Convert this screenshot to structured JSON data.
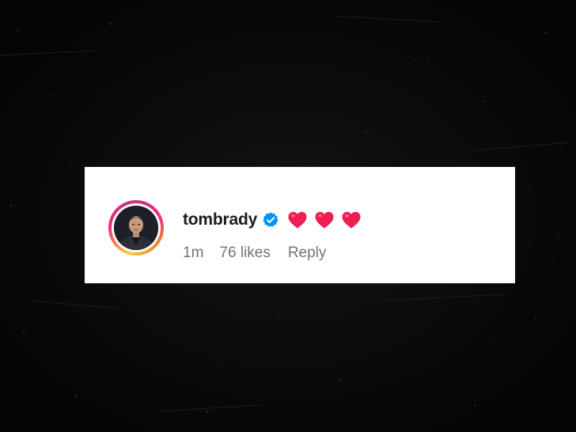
{
  "comment": {
    "username": "tombrady",
    "verified": true,
    "emoji_icons": [
      "red-heart-icon",
      "red-heart-icon",
      "red-heart-icon"
    ],
    "time": "1m",
    "likes": "76 likes",
    "reply_label": "Reply"
  },
  "colors": {
    "background": "#0a0a0a",
    "card": "#ffffff",
    "username": "#1c1c1c",
    "meta_text": "#737373",
    "verified_badge": "#0095f6",
    "heart": "#ee1d52"
  }
}
